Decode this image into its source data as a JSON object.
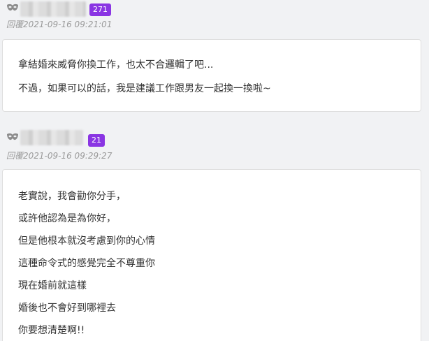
{
  "posts": [
    {
      "badge": "271",
      "reply_time": "回覆2021-09-16 09:21:01",
      "lines": [
        "拿結婚來威脅你換工作，也太不合邏輯了吧...",
        "不過，如果可以的話，我是建議工作跟男友一起換一換啦~"
      ]
    },
    {
      "badge": "21",
      "reply_time": "回覆2021-09-16 09:29:27",
      "lines": [
        "老實說，我會勸你分手，",
        "或許他認為是為你好，",
        "但是他根本就沒考慮到你的心情",
        "這種命令式的感覺完全不尊重你",
        "現在婚前就這樣",
        "婚後也不會好到哪裡去",
        "你要想清楚啊!!"
      ]
    }
  ],
  "colors": {
    "badge": "#8a35e3",
    "page_bg": "#f1f2f4",
    "card_bg": "#ffffff",
    "timestamp": "#9a9a9a"
  },
  "icons": {
    "avatar": "mask-icon"
  }
}
